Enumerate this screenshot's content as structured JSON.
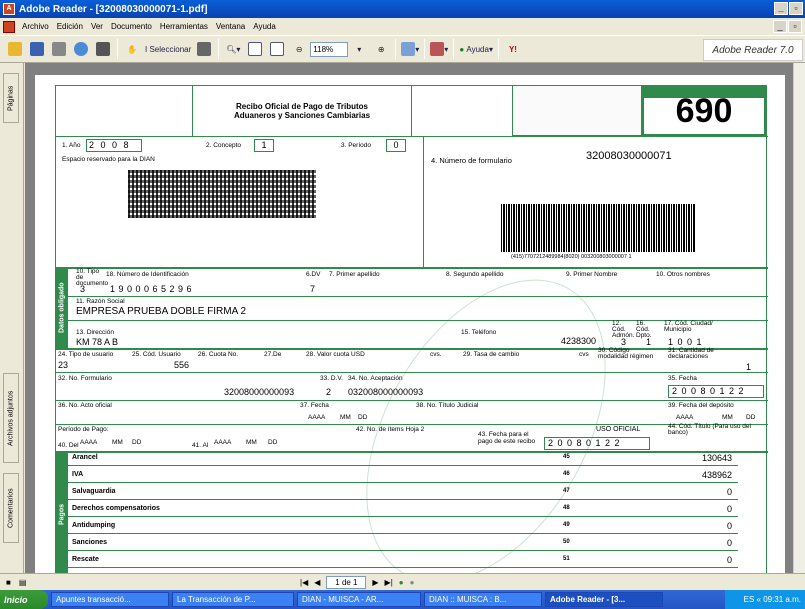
{
  "window": {
    "title": "Adobe Reader - [32008030000071-1.pdf]"
  },
  "menu": [
    "Archivo",
    "Edición",
    "Ver",
    "Documento",
    "Herramientas",
    "Ventana",
    "Ayuda"
  ],
  "toolbar": {
    "select_label": "Seleccionar",
    "zoom": "118%",
    "help_label": "Ayuda",
    "brand": "Adobe Reader",
    "brand_ver": "7.0"
  },
  "sidebar": {
    "tabs": [
      "Páginas",
      "Archivos adjuntos",
      "Comentarios"
    ]
  },
  "form": {
    "title_line1": "Recibo Oficial de Pago de Tributos",
    "title_line2": "Aduaneros y Sanciones Cambiarias",
    "number": "690",
    "anio_label": "1. Año",
    "anio": "2 0 0 8",
    "concepto_label": "2. Concepto",
    "concepto": "1",
    "periodo_label": "3. Período",
    "periodo": "0",
    "dian_label": "Espacio reservado para la DIAN",
    "form_no_label": "4. Número de formulario",
    "form_no": "32008030000071",
    "barcode_text": "(415)7707212489984(8020) 003200803000007 1",
    "tipo_doc_label": "10. Tipo de documento",
    "tipo_doc": "3",
    "nit_label": "18. Número de Identificación",
    "nit": "1   9 0 0 0 6 5 2 9 6",
    "dv_label": "6.DV",
    "dv": "7",
    "primer_ap_label": "7. Primer apellido",
    "segundo_ap_label": "8. Segundo apellido",
    "primer_nom_label": "9. Primer Nombre",
    "otros_nom_label": "10. Otros nombres",
    "razon_label": "11. Razón Social",
    "razon": "EMPRESA PRUEBA DOBLE FIRMA 2",
    "dir_label": "13. Dirección",
    "dir": "KM 78 A B",
    "tel_label": "15. Teléfono",
    "tel": "4238300",
    "cod_admin_label": "12. Cód. Admón.",
    "cod_admin": "3",
    "cod_dpto_label": "16. Cód. Dpto.",
    "cod_dpto": "1",
    "cod_ciudad_label": "17. Cód. Ciudad/ Municipio",
    "cod_ciudad": "1 0 0 1",
    "datos_obligado": "Datos obligado",
    "tipo_usuario_label": "24. Tipo de usuario",
    "tipo_usuario": "23",
    "cod_usuario_label": "25. Cód. Usuario",
    "cod_usuario": "556",
    "cuota_label": "26. Cuota No.",
    "de_label": "27.De",
    "valor_usd_label": "28. Valor cuota USD",
    "cvs_label": "cvs.",
    "tasa_label": "29. Tasa de cambio",
    "cvs2_label": "cvs",
    "modalidad_label": "30. Código modalidad régimen",
    "cant_decl_label": "31. Cantidad de declaraciones",
    "cant_decl": "1",
    "no_form_label": "32. No. Formulario",
    "no_form": "32008000000093",
    "dv2_label": "33. D.V.",
    "dv2": "2",
    "aceptacion_label": "34. No. Aceptación",
    "aceptacion": "032008000000093",
    "fecha_label": "35. Fecha",
    "fecha": "2 0 0 8 0 1 2 2",
    "acto_label": "36. No. Acto oficial",
    "fecha37_label": "37. Fecha",
    "titulo_label": "38. No. Título Judicial",
    "fecha_dep_label": "39. Fecha del depósito",
    "aaaa": "AAAA",
    "mm": "MM",
    "dd": "DD",
    "periodo_pago_label": "Período de Pago:",
    "del_label": "40. Del",
    "al_label": "41. Al",
    "items_label": "42. No. de ítems Hoja 2",
    "fecha_pago_label": "43. Fecha para el pago de este recibo",
    "fecha_pago": "2 0 0 8 0 1 2 2",
    "uso_oficial": "USO OFICIAL",
    "cod_titulo_label": "44. Cód. Título (Para uso del banco)",
    "pagos": "Pagos",
    "rows": [
      {
        "label": "Arancel",
        "num": "45",
        "value": "130643"
      },
      {
        "label": "IVA",
        "num": "46",
        "value": "438962"
      },
      {
        "label": "Salvaguardia",
        "num": "47",
        "value": "0"
      },
      {
        "label": "Derechos compensatorios",
        "num": "48",
        "value": "0"
      },
      {
        "label": "Antidumping",
        "num": "49",
        "value": "0"
      },
      {
        "label": "Sanciones",
        "num": "50",
        "value": "0"
      },
      {
        "label": "Rescate",
        "num": "51",
        "value": "0"
      }
    ]
  },
  "status": {
    "page": "1 de 1"
  },
  "taskbar": {
    "start": "Inicio",
    "tasks": [
      "Apuntes transacció...",
      "La Transacción de P...",
      "DIAN - MUISCA - AR...",
      "DIAN :: MUISCA : B...",
      "Adobe Reader - [3..."
    ],
    "time": "09:31 a.m.",
    "lang": "ES"
  }
}
